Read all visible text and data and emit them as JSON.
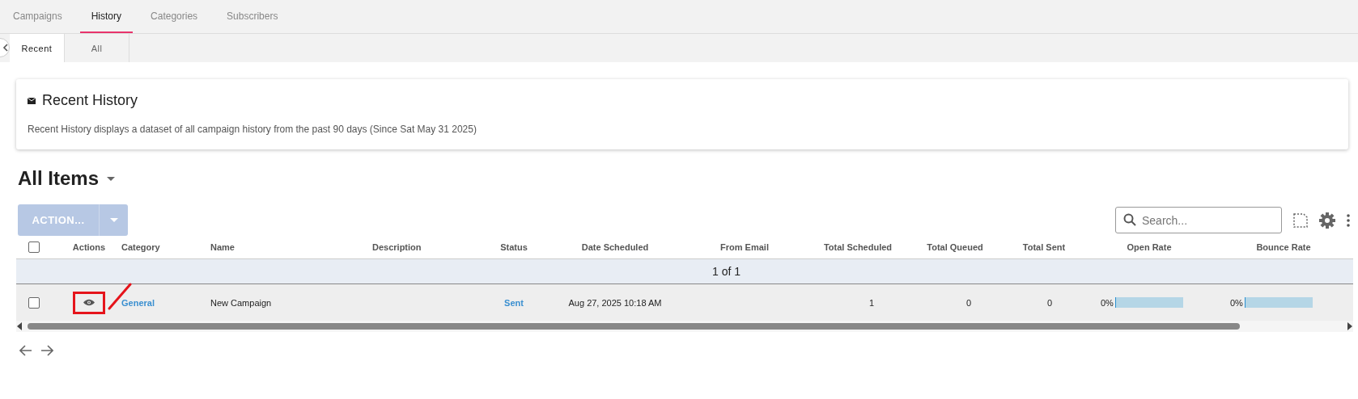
{
  "tabs": [
    {
      "label": "Campaigns",
      "selected": false
    },
    {
      "label": "History",
      "selected": true
    },
    {
      "label": "Categories",
      "selected": false
    },
    {
      "label": "Subscribers",
      "selected": false
    }
  ],
  "subtabs": [
    {
      "label": "Recent",
      "selected": true
    },
    {
      "label": "All",
      "selected": false
    }
  ],
  "card": {
    "title": "Recent History",
    "description": "Recent History displays a dataset of all campaign history from the past 90 days (Since Sat May 31 2025)"
  },
  "view_title": "All Items",
  "action_button": {
    "label": "ACTION...",
    "disabled": true
  },
  "search": {
    "placeholder": "Search..."
  },
  "table": {
    "select_all_checked": false,
    "columns": [
      "Actions",
      "Category",
      "Name",
      "Description",
      "Status",
      "Date Scheduled",
      "From Email",
      "Total Scheduled",
      "Total Queued",
      "Total Sent",
      "Open Rate",
      "Bounce Rate"
    ],
    "group_label": "1 of 1",
    "rows": [
      {
        "checked": false,
        "highlighted": true,
        "category": "General",
        "name": "New Campaign",
        "status": "Sent",
        "date_scheduled": "Aug 27, 2025 10:18 AM",
        "total_scheduled": "1",
        "total_queued": "0",
        "total_sent": "0",
        "open_rate": {
          "reading": "0%",
          "level": 0
        },
        "bounce_rate": {
          "reading": "0%",
          "level": 0
        }
      }
    ]
  }
}
